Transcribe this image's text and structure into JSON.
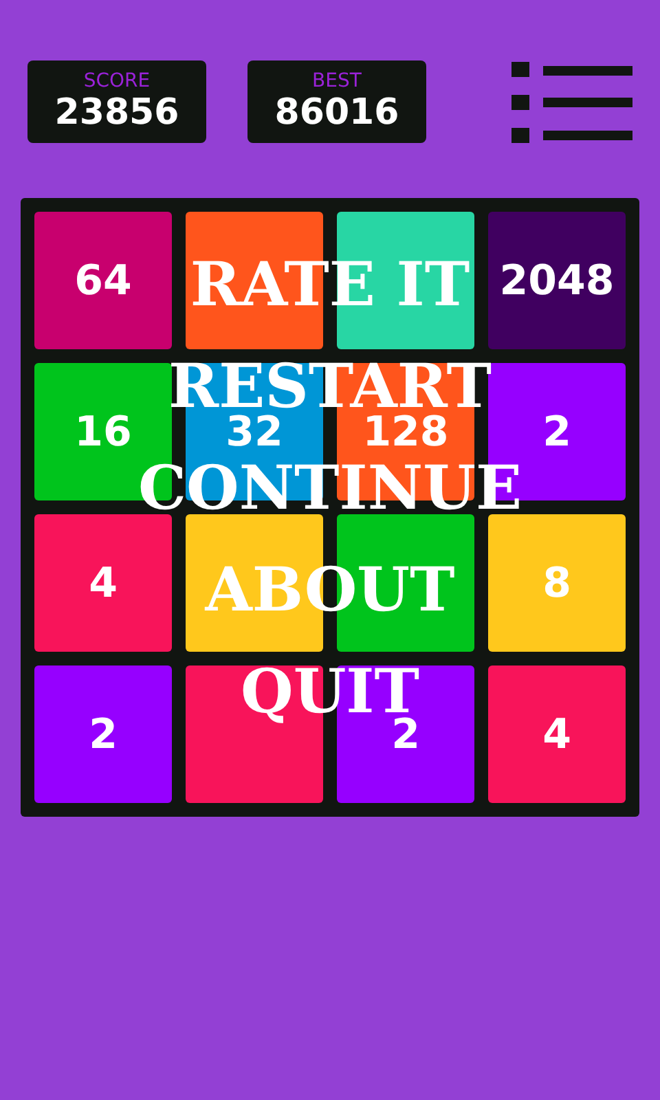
{
  "score": {
    "label": "SCORE",
    "value": "23856"
  },
  "best": {
    "label": "BEST",
    "value": "86016"
  },
  "tiles": [
    {
      "value": "64",
      "color": "#c8006e"
    },
    {
      "color": "#ff551c"
    },
    {
      "color": "#28d6a4"
    },
    {
      "value": "2048",
      "color": "#400060"
    },
    {
      "value": "16",
      "color": "#00c41c"
    },
    {
      "value": "32",
      "color": "#0096d6"
    },
    {
      "value": "128",
      "color": "#ff551c"
    },
    {
      "value": "2",
      "color": "#9600ff"
    },
    {
      "value": "4",
      "color": "#f8145a"
    },
    {
      "color": "#ffc81c"
    },
    {
      "color": "#00c41c"
    },
    {
      "value": "8",
      "color": "#ffc81c"
    },
    {
      "value": "2",
      "color": "#9600ff"
    },
    {
      "color": "#f8145a"
    },
    {
      "value": "2",
      "color": "#9600ff"
    },
    {
      "value": "4",
      "color": "#f8145a"
    }
  ],
  "menu": [
    "RATE IT",
    "RESTART",
    "CONTINUE",
    "ABOUT",
    "QUIT"
  ]
}
